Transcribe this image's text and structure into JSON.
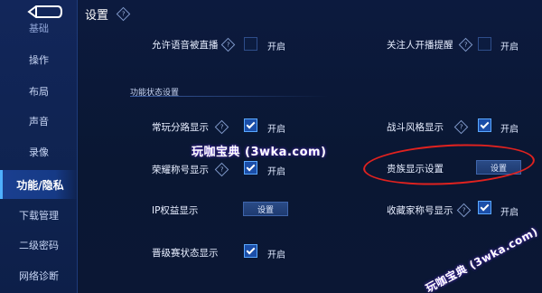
{
  "header": {
    "title": "设置"
  },
  "sidebar": {
    "items": [
      {
        "label": "基础"
      },
      {
        "label": "操作"
      },
      {
        "label": "布局"
      },
      {
        "label": "声音"
      },
      {
        "label": "录像"
      },
      {
        "label": "功能/隐私"
      },
      {
        "label": "下载管理"
      },
      {
        "label": "二级密码"
      },
      {
        "label": "网络诊断"
      }
    ]
  },
  "settings": {
    "voice_live": {
      "label": "允许语音被直播",
      "on": "开启",
      "checked": false
    },
    "follow_live": {
      "label": "关注人开播提醒",
      "on": "开启",
      "checked": false
    },
    "section_title": "功能状态设置",
    "lane_display": {
      "label": "常玩分路显示",
      "on": "开启",
      "checked": true
    },
    "battle_style": {
      "label": "战斗风格显示",
      "on": "开启",
      "checked": true
    },
    "honor_title": {
      "label": "荣耀称号显示",
      "on": "开启",
      "checked": true
    },
    "noble_display": {
      "label": "贵族显示设置",
      "button": "设置"
    },
    "ip_rights": {
      "label": "IP权益显示",
      "button": "设置"
    },
    "collector_title": {
      "label": "收藏家称号显示",
      "on": "开启",
      "checked": true
    },
    "promotion_status": {
      "label": "晋级赛状态显示",
      "on": "开启",
      "checked": true
    }
  },
  "watermarks": {
    "center": "玩咖宝典 (3wka.com)",
    "corner": "玩咖宝典 (3wka.com)"
  },
  "colors": {
    "accent_blue": "#1b4ea8",
    "annotation_red": "#e0221f",
    "background": "#0a1733"
  }
}
